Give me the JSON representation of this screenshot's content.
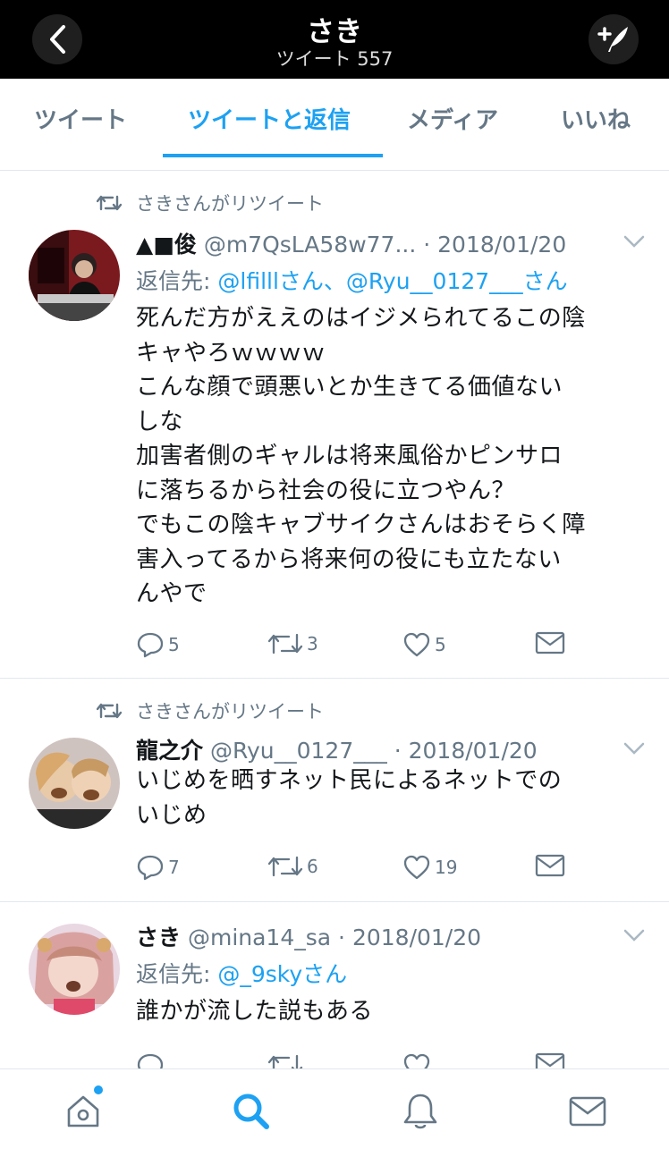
{
  "header": {
    "title": "さき",
    "subtitle": "ツイート 557",
    "back_icon": "chevron-left-icon",
    "compose_icon": "compose-tweet-icon"
  },
  "tabs": [
    {
      "label": "ツイート",
      "active": false
    },
    {
      "label": "ツイートと返信",
      "active": true
    },
    {
      "label": "メディア",
      "active": false
    },
    {
      "label": "いいね",
      "active": false
    }
  ],
  "tweets": [
    {
      "retweet_label": "さきさんがリツイート",
      "name": "▲■俊",
      "handle": "@m7QsLA58w77...",
      "date": "· 2018/01/20",
      "reply_prefix": "返信先: ",
      "reply_to": "@lfilllさん、@Ryu__0127___さん",
      "text_lines": [
        "死んだ方がええのはイジメられてるこの陰",
        "キャやろｗｗｗｗ",
        "こんな顔で頭悪いとか生きてる価値ない",
        "しな",
        "加害者側のギャルは将来風俗かピンサロ",
        "に落ちるから社会の役に立つやん？",
        "でもこの陰キャブサイクさんはおそらく障",
        "害入ってるから将来何の役にも立たない",
        "んやで"
      ],
      "replies": "5",
      "retweets": "3",
      "likes": "5"
    },
    {
      "retweet_label": "さきさんがリツイート",
      "name": "龍之介",
      "handle": "@Ryu__0127___",
      "date": "· 2018/01/20",
      "text_lines": [
        "いじめを晒すネット民によるネットでの",
        "いじめ"
      ],
      "replies": "7",
      "retweets": "6",
      "likes": "19"
    },
    {
      "name": "さき",
      "handle": "@mina14_sa",
      "date": "· 2018/01/20",
      "reply_prefix": "返信先: ",
      "reply_to": "@_9skyさん",
      "text_lines": [
        "誰かが流した説もある"
      ]
    }
  ],
  "bottom_nav": [
    {
      "icon": "home-icon",
      "has_notification_dot": true
    },
    {
      "icon": "search-icon",
      "active": true
    },
    {
      "icon": "bell-icon"
    },
    {
      "icon": "mail-icon"
    }
  ],
  "colors": {
    "accent": "#1da1f2",
    "muted": "#657786",
    "header_bg": "#000000"
  }
}
